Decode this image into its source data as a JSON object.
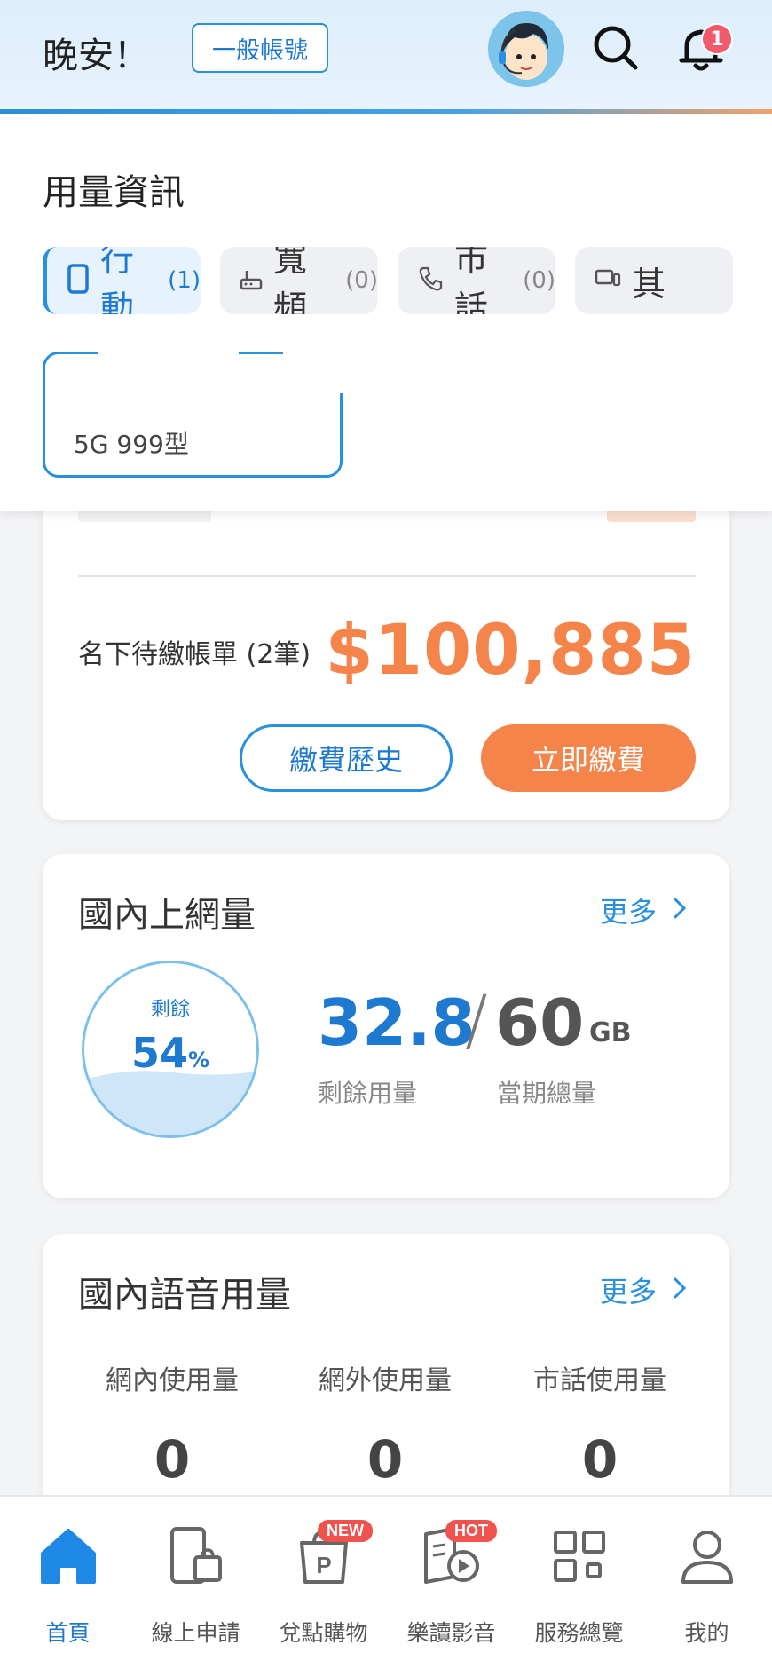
{
  "header": {
    "greeting": "晚安！",
    "account_badge": "一般帳號",
    "notification_count": "1"
  },
  "usage": {
    "title": "用量資訊",
    "tabs": [
      {
        "label": "行動",
        "count": "(1)",
        "icon": "mobile-icon"
      },
      {
        "label": "寬頻",
        "count": "(0)",
        "icon": "router-icon"
      },
      {
        "label": "市話",
        "count": "(0)",
        "icon": "phone-icon"
      },
      {
        "label": "其",
        "count": "",
        "icon": "device-icon"
      }
    ],
    "plan_name": "5G 999型"
  },
  "bill": {
    "label": "名下待繳帳單 (2筆)",
    "amount": "$100,885",
    "history_button": "繳費歷史",
    "pay_button": "立即繳費"
  },
  "data_usage": {
    "title": "國內上網量",
    "more": "更多",
    "gauge_label": "剩餘",
    "gauge_percent": "54",
    "gauge_percent_unit": "%",
    "remaining_fraction": 0.54,
    "remaining": "32.8",
    "total": "60",
    "unit": "GB",
    "remaining_label": "剩餘用量",
    "total_label": "當期總量"
  },
  "voice_usage": {
    "title": "國內語音用量",
    "more": "更多",
    "columns": [
      {
        "label": "網內使用量",
        "value": "0"
      },
      {
        "label": "網外使用量",
        "value": "0"
      },
      {
        "label": "市話使用量",
        "value": "0"
      }
    ]
  },
  "bottom_nav": {
    "items": [
      {
        "label": "首頁",
        "icon": "home-icon",
        "tag": ""
      },
      {
        "label": "線上申請",
        "icon": "apply-icon",
        "tag": ""
      },
      {
        "label": "兌點購物",
        "icon": "points-shop-icon",
        "tag": "NEW"
      },
      {
        "label": "樂讀影音",
        "icon": "media-icon",
        "tag": "HOT"
      },
      {
        "label": "服務總覽",
        "icon": "services-grid-icon",
        "tag": ""
      },
      {
        "label": "我的",
        "icon": "profile-icon",
        "tag": ""
      }
    ]
  },
  "colors": {
    "accent": "#2a8fdc",
    "orange": "#f4844a",
    "badge_red": "#f05a6a"
  }
}
